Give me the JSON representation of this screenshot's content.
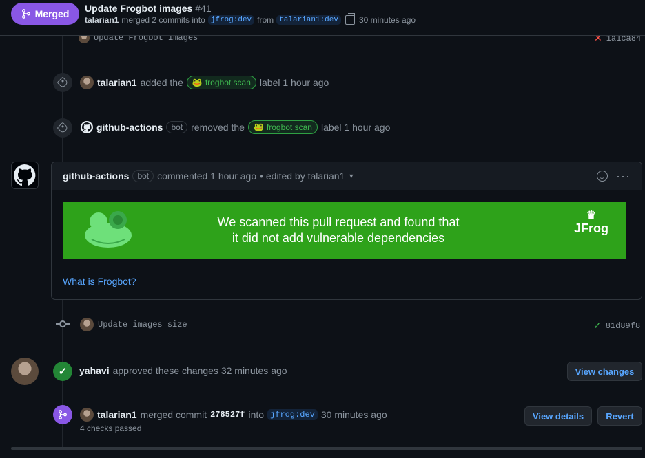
{
  "header": {
    "status_label": "Merged",
    "title": "Update Frogbot images",
    "number": "#41",
    "author": "talarian1",
    "merged_text": "merged 2 commits into",
    "base_branch": "jfrog:dev",
    "from_text": "from",
    "head_branch": "talarian1:dev",
    "time": "30 minutes ago"
  },
  "timeline": {
    "commit1": {
      "message": "Update Frogbot images",
      "sha": "1a1ca84"
    },
    "label_added": {
      "user": "talarian1",
      "action": "added the",
      "label": "frogbot scan",
      "suffix": "label 1 hour ago"
    },
    "label_removed": {
      "user": "github-actions",
      "bot": "bot",
      "action": "removed the",
      "label": "frogbot scan",
      "suffix": "label 1 hour ago"
    },
    "comment": {
      "user": "github-actions",
      "bot": "bot",
      "meta": "commented 1 hour ago",
      "edited": "• edited by talarian1",
      "banner_line1": "We scanned this pull request and found that",
      "banner_line2": "it did not add vulnerable dependencies",
      "brand": "JFrog",
      "link": "What is Frogbot?"
    },
    "commit2": {
      "message": "Update images size",
      "sha": "81d89f8"
    },
    "review": {
      "user": "yahavi",
      "text": "approved these changes 32 minutes ago",
      "button": "View changes"
    },
    "merge": {
      "user": "talarian1",
      "text": "merged commit",
      "commit": "278527f",
      "into": "into",
      "branch": "jfrog:dev",
      "time": "30 minutes ago",
      "checks": "4 checks passed",
      "details_button": "View details",
      "revert_button": "Revert"
    }
  },
  "colors": {
    "merged": "#8957e5",
    "approved": "#238636",
    "label_green": "#3fb950",
    "banner": "#2ea21a",
    "link": "#58a6ff"
  }
}
